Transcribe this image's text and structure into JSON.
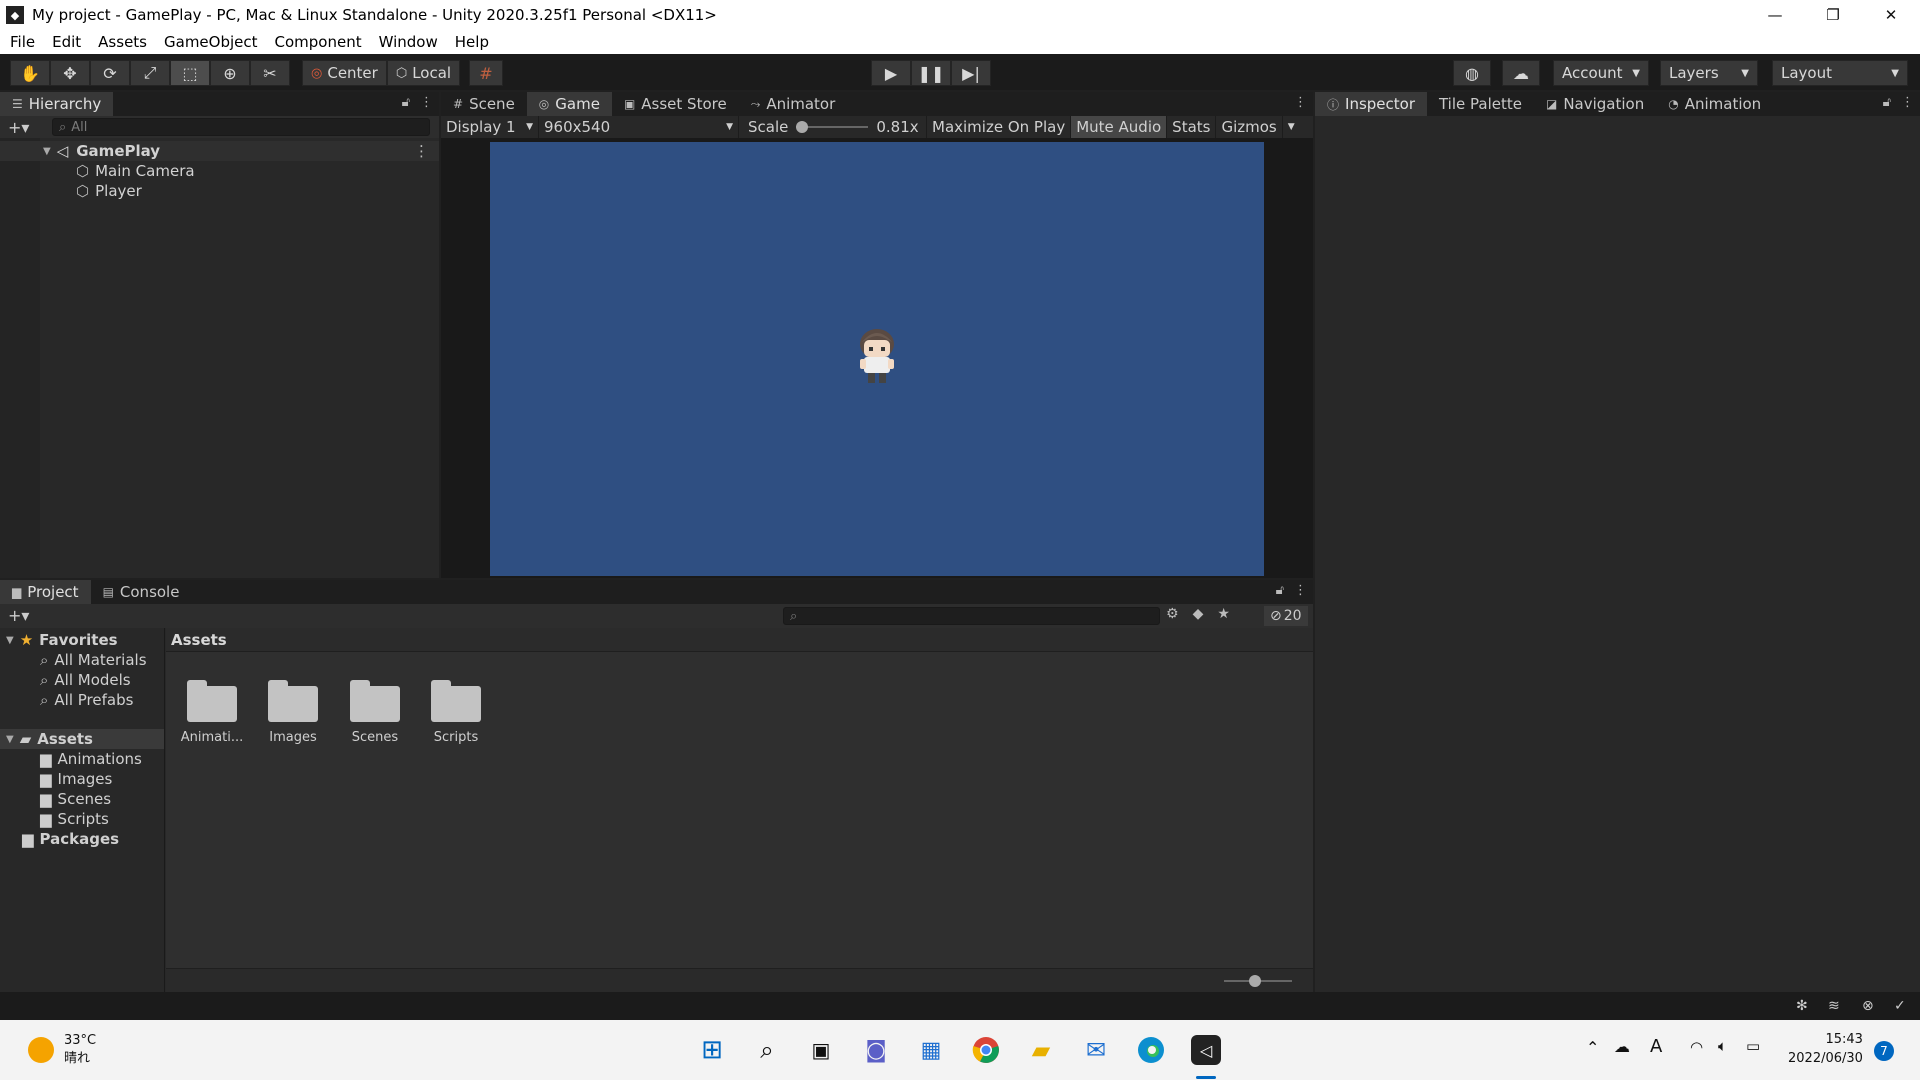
{
  "window": {
    "title": "My project - GamePlay - PC, Mac & Linux Standalone - Unity 2020.3.25f1 Personal <DX11>",
    "minimize": "—",
    "restore": "❐",
    "close": "✕"
  },
  "menu": [
    "File",
    "Edit",
    "Assets",
    "GameObject",
    "Component",
    "Window",
    "Help"
  ],
  "toolbar": {
    "pivot_label": "Center",
    "space_label": "Local",
    "account_label": "Account",
    "layers_label": "Layers",
    "layout_label": "Layout"
  },
  "hierarchy": {
    "tab_label": "Hierarchy",
    "search_placeholder": "All",
    "scene": "GamePlay",
    "objects": [
      "Main Camera",
      "Player"
    ]
  },
  "center_tabs": [
    "Scene",
    "Game",
    "Asset Store",
    "Animator"
  ],
  "game_bar": {
    "display": "Display 1",
    "resolution": "960x540",
    "scale_label": "Scale",
    "scale_value": "0.81x",
    "scale_fraction": 0.0,
    "maximize": "Maximize On Play",
    "mute": "Mute Audio",
    "stats": "Stats",
    "gizmos": "Gizmos"
  },
  "game_background": "#2f4f82",
  "right_tabs": [
    "Inspector",
    "Tile Palette",
    "Navigation",
    "Animation"
  ],
  "project": {
    "tabs": [
      "Project",
      "Console"
    ],
    "hidden_count": "20",
    "favorites_label": "Favorites",
    "favorites": [
      "All Materials",
      "All Models",
      "All Prefabs"
    ],
    "assets_label": "Assets",
    "asset_folders": [
      "Animations",
      "Images",
      "Scenes",
      "Scripts"
    ],
    "packages_label": "Packages",
    "breadcrumb": "Assets",
    "grid_items": [
      "Animati...",
      "Images",
      "Scenes",
      "Scripts"
    ],
    "zoom_fraction": 0.45
  },
  "taskbar": {
    "temperature": "33°C",
    "weather": "晴れ",
    "time": "15:43",
    "date": "2022/06/30",
    "notification_count": "7",
    "ime": "A"
  }
}
